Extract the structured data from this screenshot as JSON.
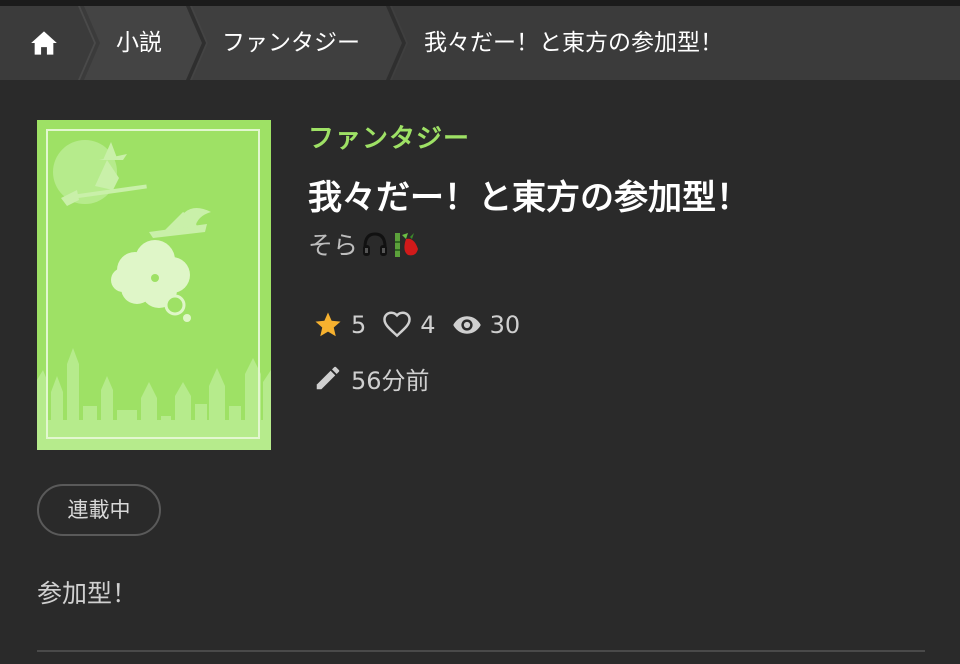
{
  "breadcrumb": {
    "home_icon": "home-icon",
    "items": [
      "小説",
      "ファンタジー",
      "我々だー！と東方の参加型！"
    ]
  },
  "cover": {
    "background": "#9ee165",
    "art": [
      "witch-on-broom",
      "witch-hat",
      "thought-bubble",
      "castle-skyline"
    ]
  },
  "novel": {
    "genre": "ファンタジー",
    "title": "我々だー！と東方の参加型！",
    "author": "そら",
    "author_emojis": [
      "headphones-emoji",
      "bamboo-emoji"
    ],
    "stats": {
      "stars": "5",
      "likes": "4",
      "views": "30"
    },
    "updated": "56分前",
    "status": "連載中",
    "description": "参加型！"
  },
  "colors": {
    "accent": "#9ee165",
    "background": "#2a2a2a",
    "breadcrumb_bg": "#3b3b3b",
    "star": "#f6b12f"
  }
}
